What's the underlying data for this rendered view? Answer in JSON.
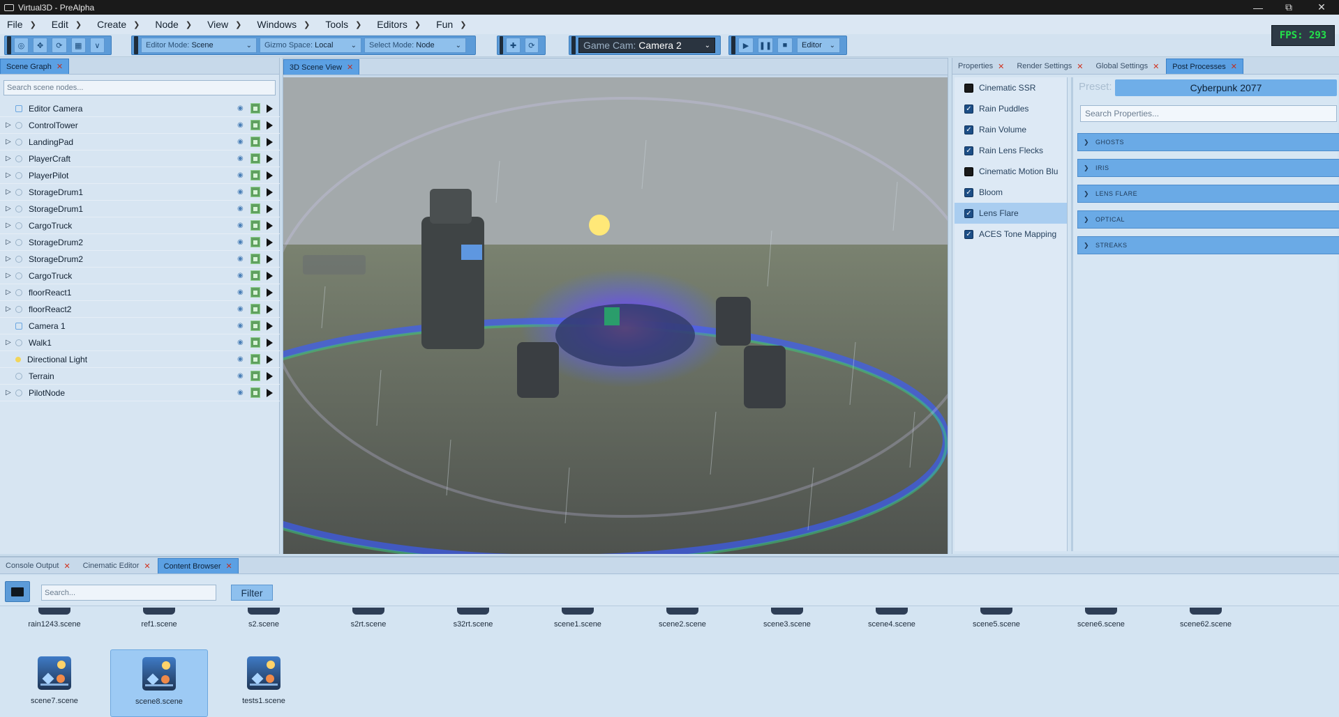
{
  "window": {
    "title": "Virtual3D - PreAlpha"
  },
  "menu": [
    "File",
    "Edit",
    "Create",
    "Node",
    "View",
    "Windows",
    "Tools",
    "Editors",
    "Fun"
  ],
  "toolbar": {
    "editor_mode_label": "Editor Mode:",
    "editor_mode_value": "Scene",
    "gizmo_space_label": "Gizmo Space:",
    "gizmo_space_value": "Local",
    "select_mode_label": "Select Mode:",
    "select_mode_value": "Node",
    "game_cam_label": "Game Cam:",
    "game_cam_value": "Camera 2",
    "play_mode_value": "Editor"
  },
  "fps": "FPS: 293",
  "scene_graph": {
    "tab": "Scene Graph",
    "search_placeholder": "Search scene nodes...",
    "nodes": [
      {
        "label": "Editor Camera",
        "expandable": false,
        "icon": "camera-icon"
      },
      {
        "label": "ControlTower",
        "expandable": true,
        "icon": "node-icon"
      },
      {
        "label": "LandingPad",
        "expandable": true,
        "icon": "node-icon"
      },
      {
        "label": "PlayerCraft",
        "expandable": true,
        "icon": "node-icon"
      },
      {
        "label": "PlayerPilot",
        "expandable": true,
        "icon": "node-icon"
      },
      {
        "label": "StorageDrum1",
        "expandable": true,
        "icon": "node-icon"
      },
      {
        "label": "StorageDrum1",
        "expandable": true,
        "icon": "node-icon"
      },
      {
        "label": "CargoTruck",
        "expandable": true,
        "icon": "node-icon"
      },
      {
        "label": "StorageDrum2",
        "expandable": true,
        "icon": "node-icon"
      },
      {
        "label": "StorageDrum2",
        "expandable": true,
        "icon": "node-icon"
      },
      {
        "label": "CargoTruck",
        "expandable": true,
        "icon": "node-icon"
      },
      {
        "label": "floorReact1",
        "expandable": true,
        "icon": "node-icon"
      },
      {
        "label": "floorReact2",
        "expandable": true,
        "icon": "node-icon"
      },
      {
        "label": "Camera 1",
        "expandable": false,
        "icon": "camera-icon"
      },
      {
        "label": "Walk1",
        "expandable": true,
        "icon": "node-icon"
      },
      {
        "label": "Directional Light",
        "expandable": false,
        "icon": "light-icon"
      },
      {
        "label": "Terrain",
        "expandable": false,
        "icon": "node-icon"
      },
      {
        "label": "PilotNode",
        "expandable": true,
        "icon": "node-icon"
      }
    ]
  },
  "scene_view": {
    "tab": "3D Scene View"
  },
  "right_panel": {
    "tabs": [
      "Properties",
      "Render Settings",
      "Global Settings",
      "Post Processes"
    ],
    "active_tab": "Post Processes",
    "effects": [
      {
        "label": "Cinematic SSR",
        "checked": false
      },
      {
        "label": "Rain Puddles",
        "checked": true
      },
      {
        "label": "Rain Volume",
        "checked": true
      },
      {
        "label": "Rain Lens Flecks",
        "checked": true
      },
      {
        "label": "Cinematic Motion Blu",
        "checked": false
      },
      {
        "label": "Bloom",
        "checked": true
      },
      {
        "label": "Lens Flare",
        "checked": true
      },
      {
        "label": "ACES Tone Mapping",
        "checked": true
      }
    ],
    "selected_effect": "Lens Flare",
    "preset_label": "Preset:",
    "preset_value": "Cyberpunk 2077",
    "search_placeholder": "Search Properties...",
    "sections": [
      "GHOSTS",
      "IRIS",
      "LENS FLARE",
      "OPTICAL",
      "STREAKS"
    ]
  },
  "bottom_panel": {
    "tabs": [
      "Console Output",
      "Cinematic Editor",
      "Content Browser"
    ],
    "active_tab": "Content Browser",
    "search_placeholder": "Search...",
    "filter_label": "Filter",
    "files_row1": [
      "rain1243.scene",
      "ref1.scene",
      "s2.scene",
      "s2rt.scene",
      "s32rt.scene",
      "scene1.scene",
      "scene2.scene",
      "scene3.scene",
      "scene4.scene",
      "scene5.scene",
      "scene6.scene",
      "scene62.scene"
    ],
    "files_row2": [
      "scene7.scene",
      "scene8.scene",
      "tests1.scene"
    ],
    "selected_file": "scene8.scene"
  },
  "colors": {
    "accent": "#5ba0e3",
    "fps_text": "#22e34a",
    "close_x": "#d0321e"
  }
}
